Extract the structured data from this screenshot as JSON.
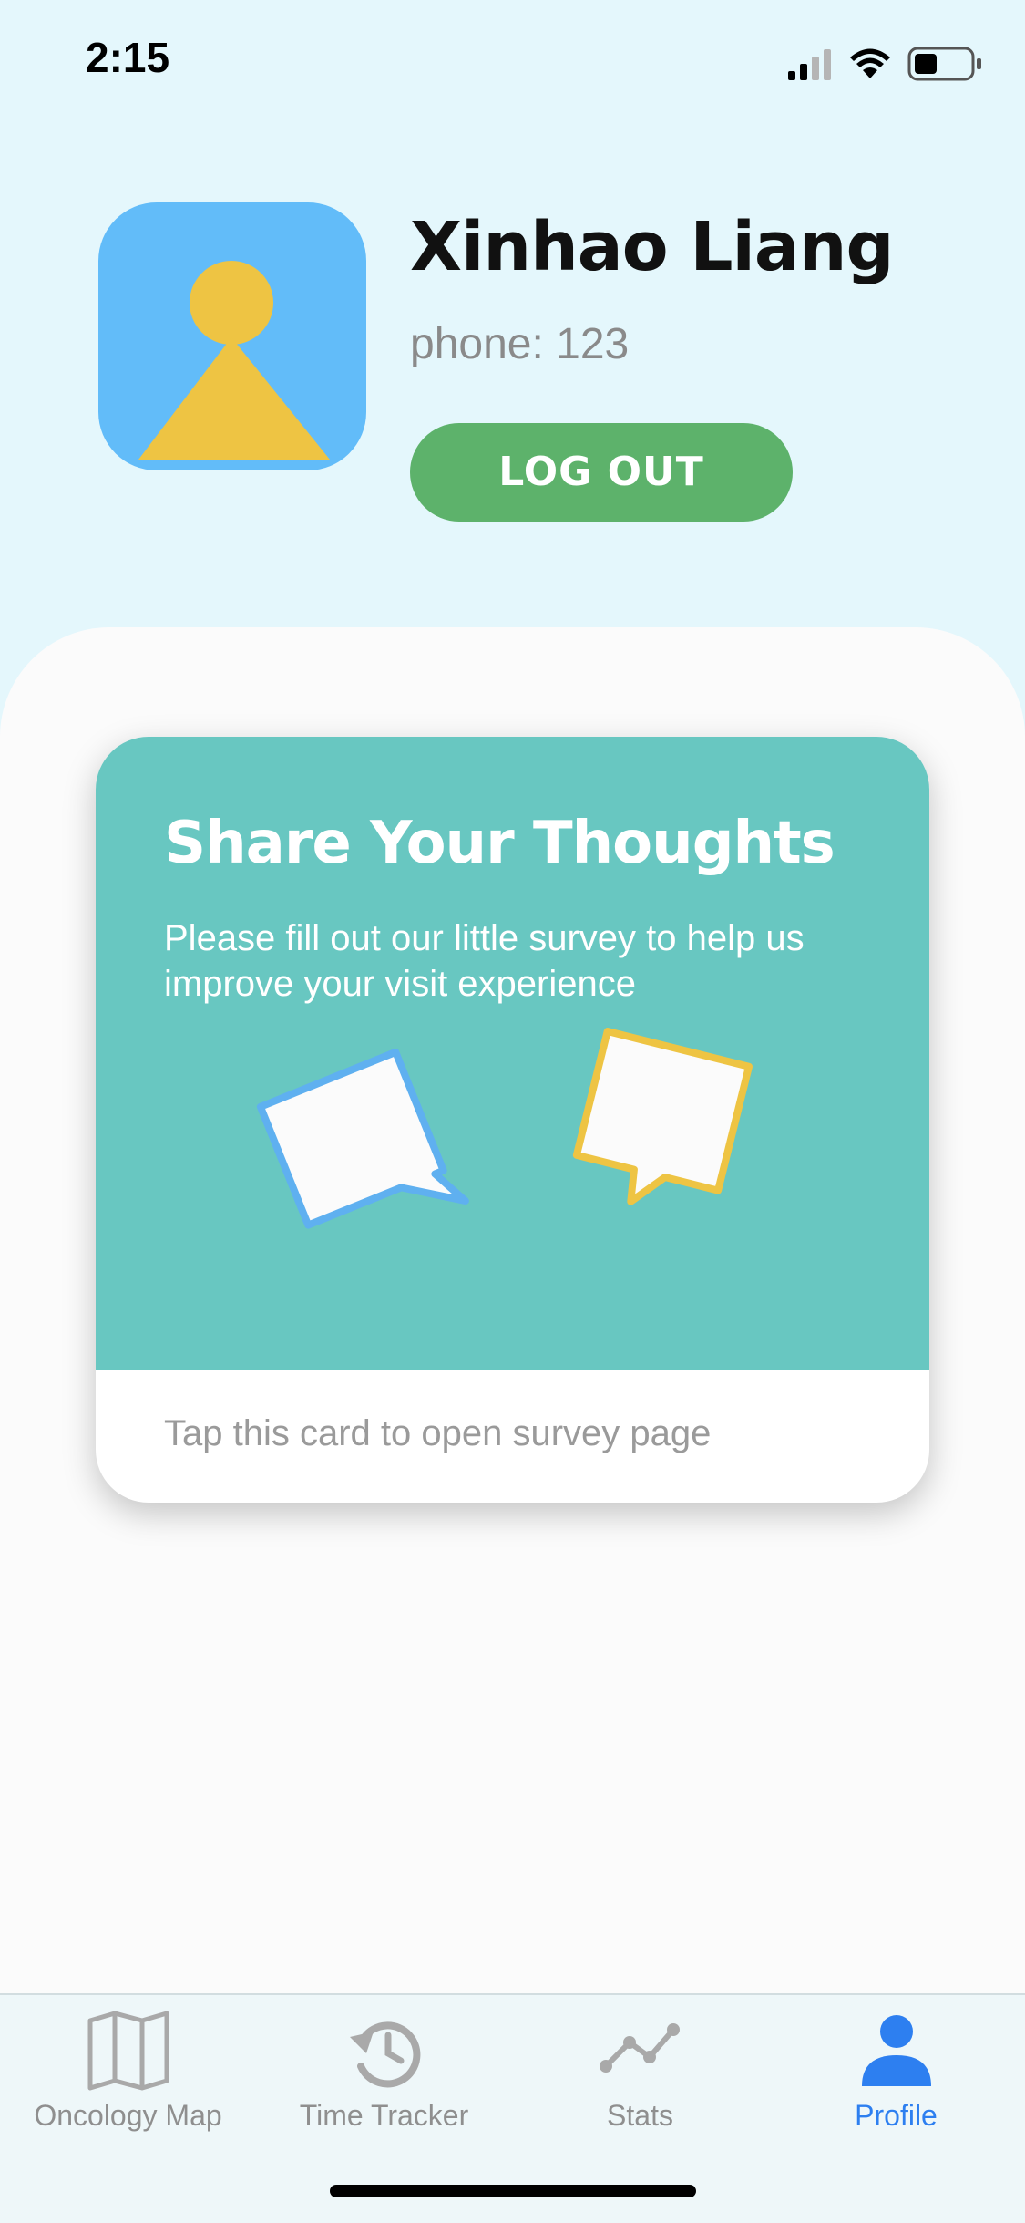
{
  "status_bar": {
    "time": "2:15"
  },
  "profile": {
    "name": "Xinhao Liang",
    "phone": "phone: 123",
    "logout_label": "LOG OUT"
  },
  "survey_card": {
    "title": "Share Your Thoughts",
    "description": "Please fill out our little survey to help us improve your visit experience",
    "footer": "Tap this card to open survey page"
  },
  "tabs": [
    {
      "label": "Oncology Map",
      "icon": "map-icon",
      "active": false
    },
    {
      "label": "Time Tracker",
      "icon": "history-icon",
      "active": false
    },
    {
      "label": "Stats",
      "icon": "stats-line-icon",
      "active": false
    },
    {
      "label": "Profile",
      "icon": "person-icon",
      "active": true
    }
  ],
  "colors": {
    "background": "#e4f7fc",
    "avatar_bg": "#62bcf9",
    "avatar_figure": "#eec443",
    "logout_button": "#5db26b",
    "card_teal": "#68c7c1",
    "active_tab": "#2d7ff0",
    "inactive_tab": "#8f8f8f"
  }
}
